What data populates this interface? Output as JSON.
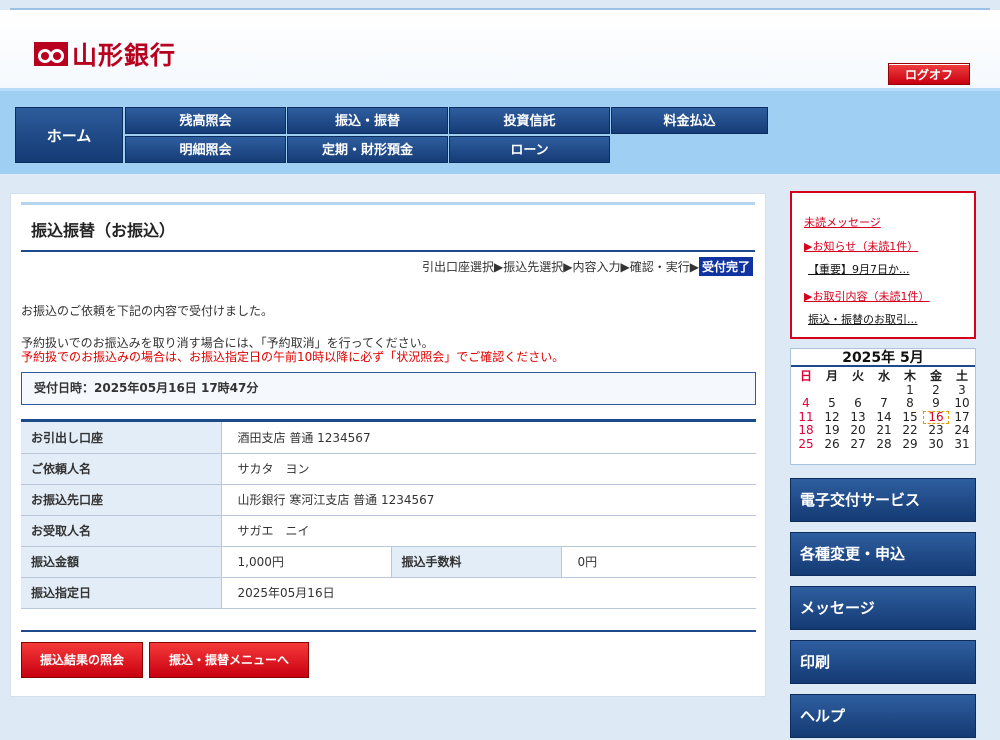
{
  "header": {
    "bank_name": "山形銀行",
    "logoff_label": "ログオフ",
    "brand_color": "#b8001f"
  },
  "nav": {
    "home": "ホーム",
    "row1": [
      "残高照会",
      "振込・振替",
      "投資信託",
      "料金払込"
    ],
    "row2": [
      "明細照会",
      "定期・財形預金",
      "ローン"
    ]
  },
  "main": {
    "title": "振込振替（お振込）",
    "steps": [
      "引出口座選択",
      "振込先選択",
      "内容入力",
      "確認・実行"
    ],
    "step_sep": "▶",
    "current_step": "受付完了",
    "message1": "お振込のご依頼を下記の内容で受付けました。",
    "message2": "予約扱いでのお振込みを取り消す場合には、「予約取消」を行ってください。",
    "message3": "予約扱でのお振込みの場合は、お振込指定日の午前10時以降に必ず「状況照会」でご確認ください。",
    "received": "受付日時：2025年05月16日 17時47分",
    "rows": [
      {
        "label": "お引出し口座",
        "value": "酒田支店 普通 1234567"
      },
      {
        "label": "ご依頼人名",
        "value": "サカタ　ヨン"
      },
      {
        "label": "お振込先口座",
        "value": "山形銀行 寒河江支店 普通 1234567"
      },
      {
        "label": "お受取人名",
        "value": "サガエ　ニイ"
      }
    ],
    "amount_label": "振込金額",
    "amount_value": "1,000円",
    "fee_label": "振込手数料",
    "fee_value": "0円",
    "date_label": "振込指定日",
    "date_value": "2025年05月16日",
    "btn_result": "振込結果の照会",
    "btn_menu": "振込・振替メニューへ"
  },
  "side": {
    "unread": "未読メッセージ",
    "notice": "▶お知らせ（未読1件）",
    "notice_item": "【重要】9月7日か...",
    "trade": "▶お取引内容（未読1件）",
    "trade_item": "振込・振替のお取引...",
    "calendar_title": "2025年 5月",
    "weekdays": [
      "日",
      "月",
      "火",
      "水",
      "木",
      "金",
      "土"
    ],
    "weeks": [
      [
        "",
        "",
        "",
        "",
        "1",
        "2",
        "3"
      ],
      [
        "4",
        "5",
        "6",
        "7",
        "8",
        "9",
        "10"
      ],
      [
        "11",
        "12",
        "13",
        "14",
        "15",
        "16",
        "17"
      ],
      [
        "18",
        "19",
        "20",
        "21",
        "22",
        "23",
        "24"
      ],
      [
        "25",
        "26",
        "27",
        "28",
        "29",
        "30",
        "31"
      ]
    ],
    "today": "16",
    "buttons": [
      "電子交付サービス",
      "各種変更・申込",
      "メッセージ",
      "印刷",
      "ヘルプ"
    ]
  }
}
